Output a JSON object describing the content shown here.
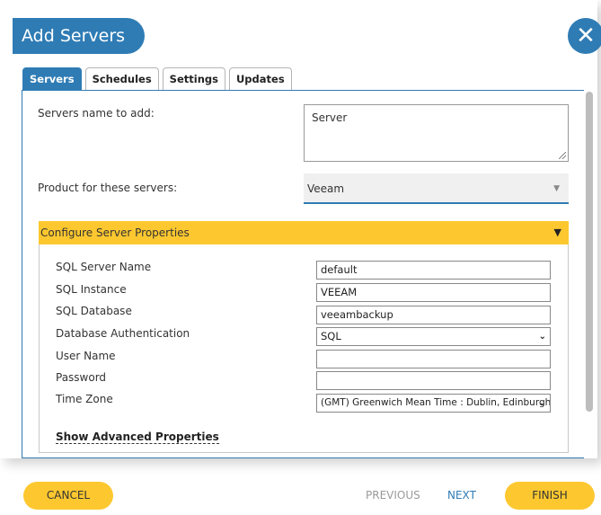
{
  "dialog": {
    "title": "Add Servers",
    "close_symbol": "✕"
  },
  "tabs": [
    {
      "label": "Servers",
      "active": true
    },
    {
      "label": "Schedules",
      "active": false
    },
    {
      "label": "Settings",
      "active": false
    },
    {
      "label": "Updates",
      "active": false
    }
  ],
  "form": {
    "servers_label": "Servers name to add:",
    "servers_value": "Server",
    "product_label": "Product for these servers:",
    "product_value": "Veeam"
  },
  "section": {
    "title": "Configure Server Properties",
    "toggle_symbol": "▼"
  },
  "properties": {
    "sql_server_name_label": "SQL Server Name",
    "sql_server_name_value": "default",
    "sql_instance_label": "SQL Instance",
    "sql_instance_value": "VEEAM",
    "sql_database_label": "SQL Database",
    "sql_database_value": "veeambackup",
    "db_auth_label": "Database Authentication",
    "db_auth_value": "SQL",
    "user_name_label": "User Name",
    "user_name_value": "",
    "password_label": "Password",
    "password_value": "",
    "time_zone_label": "Time Zone",
    "time_zone_value": "(GMT) Greenwich Mean Time : Dublin, Edinburgh"
  },
  "advanced_link": "Show Advanced Properties",
  "footer": {
    "cancel": "CANCEL",
    "previous": "PREVIOUS",
    "next": "NEXT",
    "finish": "FINISH"
  },
  "colors": {
    "accent": "#2f7cb5",
    "highlight": "#fdc82f",
    "disabled": "#9a9a9a"
  }
}
